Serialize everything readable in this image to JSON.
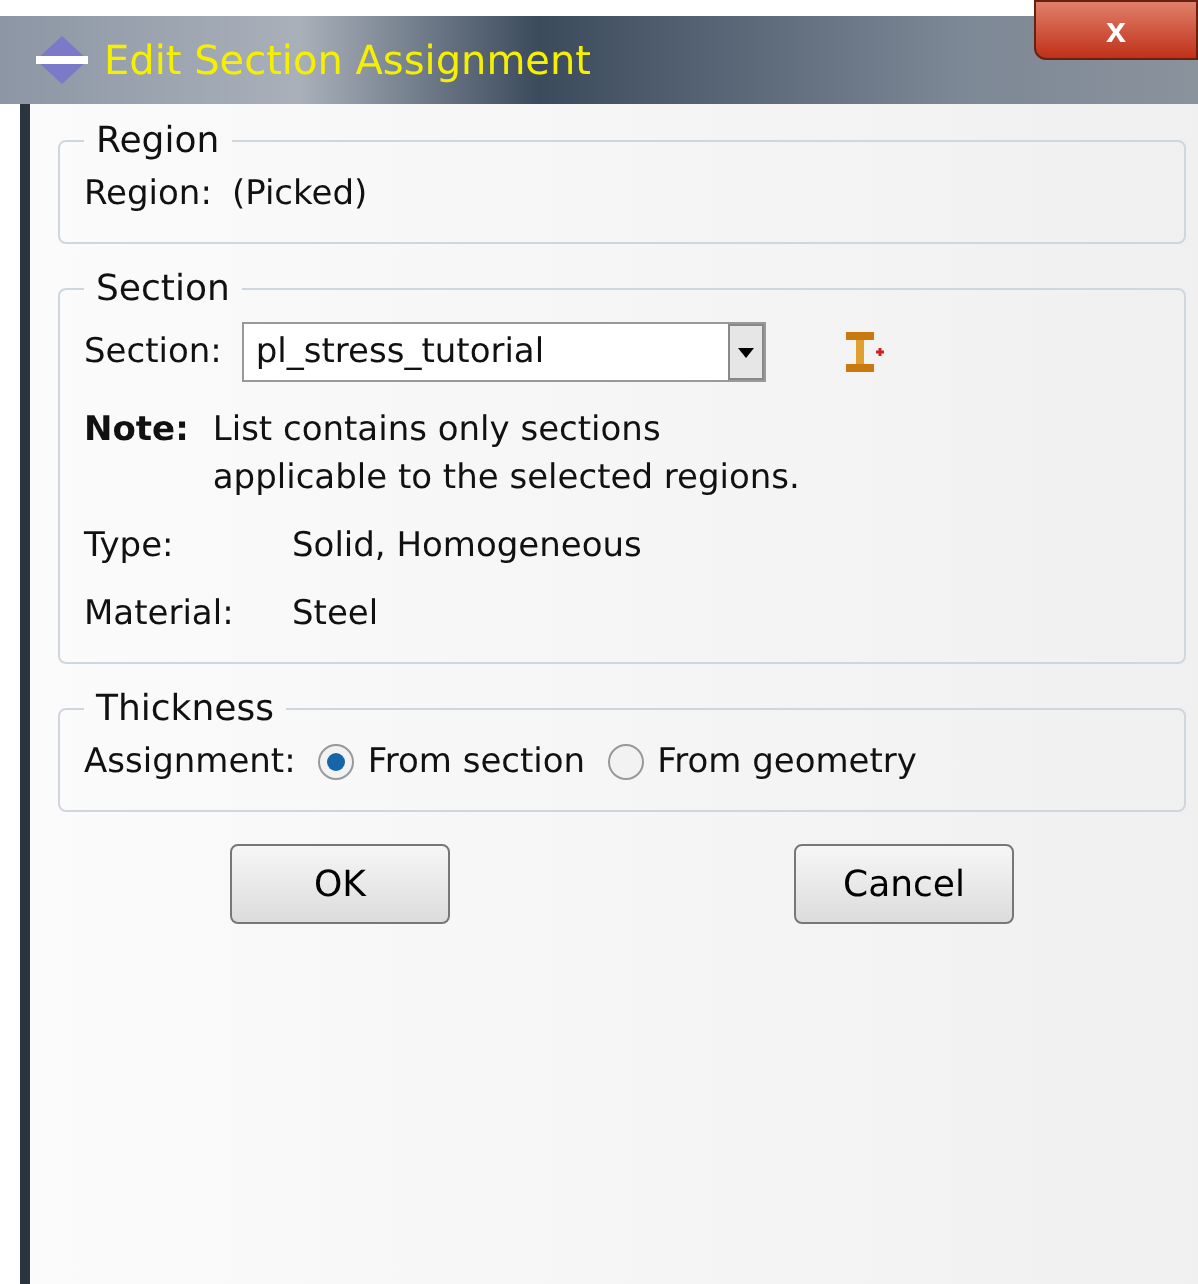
{
  "window": {
    "title": "Edit Section Assignment",
    "close": "x"
  },
  "region": {
    "title": "Region",
    "label": "Region:",
    "value": "(Picked)"
  },
  "section": {
    "title": "Section",
    "label": "Section:",
    "value": "pl_stress_tutorial",
    "note_label": "Note:",
    "note": [
      "List contains only sections",
      "applicable to the selected regions."
    ],
    "fields": [
      {
        "label": "Type:",
        "value": "Solid, Homogeneous"
      },
      {
        "label": "Material:",
        "value": "Steel"
      }
    ]
  },
  "thickness": {
    "title": "Thickness",
    "label": "Assignment:",
    "options": [
      {
        "label": "From section",
        "selected": true
      },
      {
        "label": "From geometry",
        "selected": false
      }
    ]
  },
  "buttons": [
    "OK",
    "Cancel"
  ]
}
